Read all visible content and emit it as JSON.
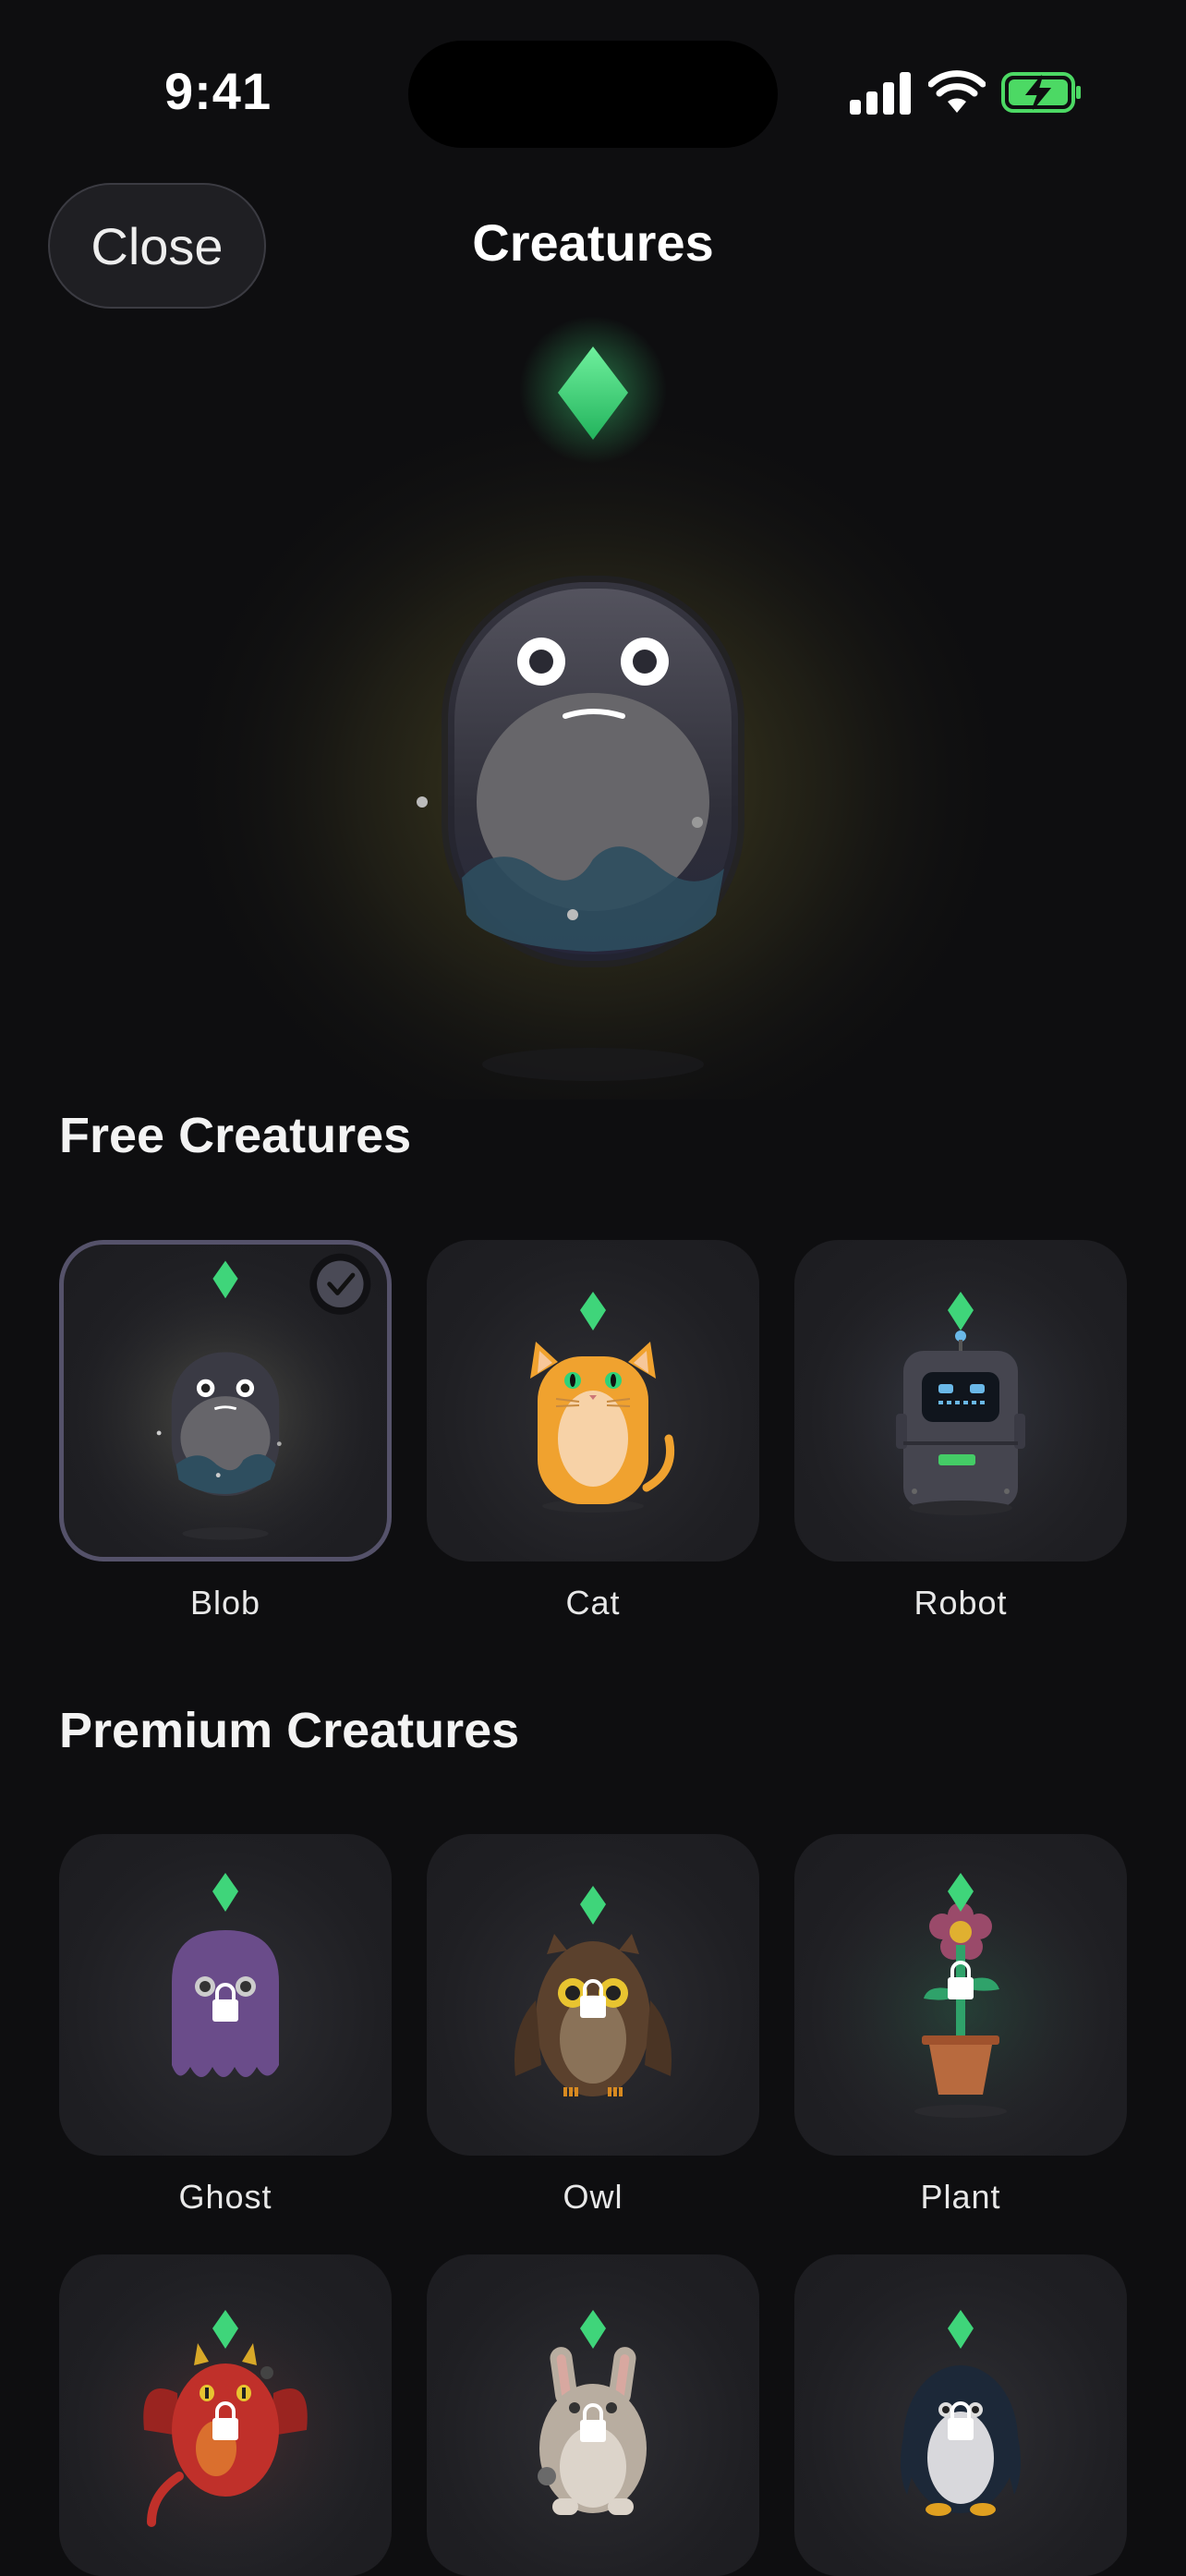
{
  "status_bar": {
    "time": "9:41"
  },
  "nav": {
    "close_label": "Close",
    "title": "Creatures"
  },
  "sections": {
    "free": {
      "title": "Free Creatures",
      "items": [
        {
          "name": "Blob",
          "selected": true,
          "locked": false
        },
        {
          "name": "Cat",
          "selected": false,
          "locked": false
        },
        {
          "name": "Robot",
          "selected": false,
          "locked": false
        }
      ]
    },
    "premium": {
      "title": "Premium Creatures",
      "items": [
        {
          "name": "Ghost",
          "locked": true
        },
        {
          "name": "Owl",
          "locked": true
        },
        {
          "name": "Plant",
          "locked": true
        },
        {
          "name": "Dragon",
          "locked": true
        },
        {
          "name": "Bunny",
          "locked": true
        },
        {
          "name": "Penguin",
          "locked": true
        }
      ]
    }
  },
  "colors": {
    "gem": "#3fd57a",
    "background": "#0e0e10",
    "card": "#1f1f23"
  }
}
